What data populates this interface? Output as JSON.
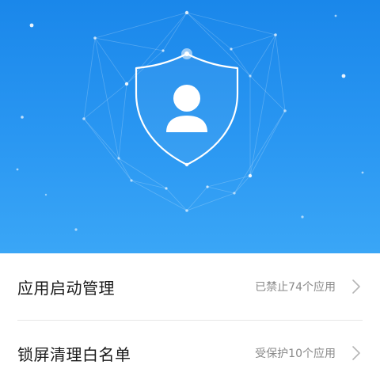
{
  "header": {
    "icon": "shield-user-icon",
    "accent_color": "#1a87ea"
  },
  "list": {
    "items": [
      {
        "title": "应用启动管理",
        "status": "已禁止74个应用",
        "icon": "chevron-right-icon"
      },
      {
        "title": "锁屏清理白名单",
        "status": "受保护10个应用",
        "icon": "chevron-right-icon"
      }
    ]
  }
}
